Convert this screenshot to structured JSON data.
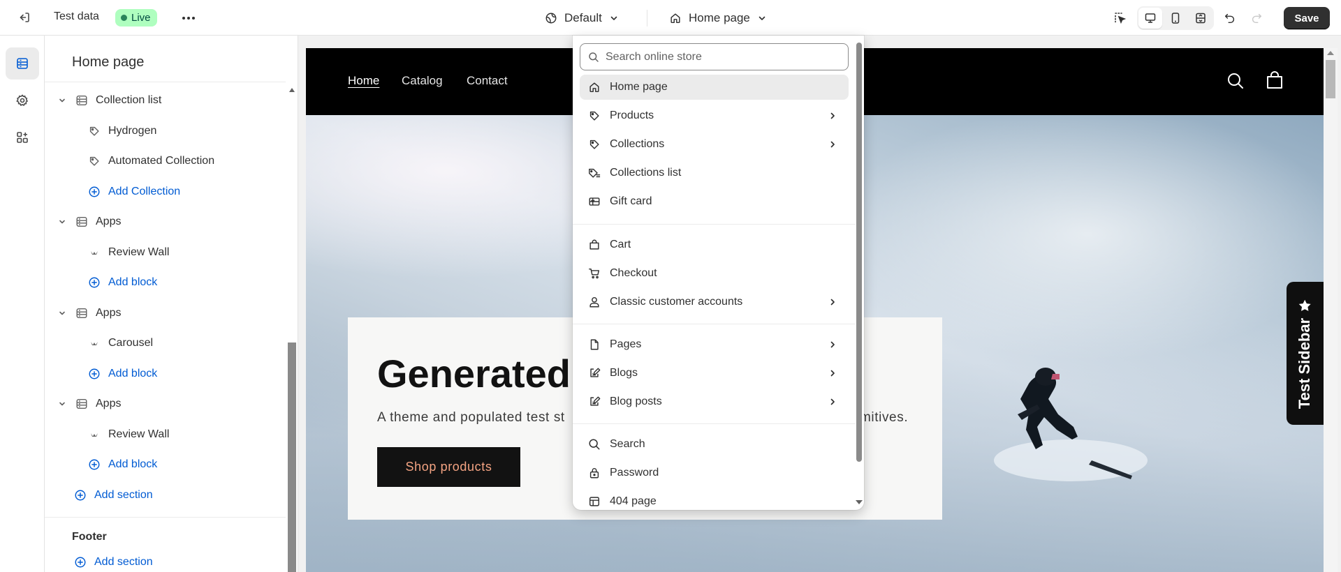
{
  "topbar": {
    "store_name": "Test data",
    "status": "Live",
    "theme": "Default",
    "template": "Home page",
    "save_label": "Save"
  },
  "sidebar": {
    "title": "Home page",
    "rows": [
      {
        "type": "section",
        "label": "Collection list",
        "icon": "section-icon"
      },
      {
        "type": "block",
        "label": "Hydrogen",
        "icon": "tag-icon"
      },
      {
        "type": "block",
        "label": "Automated Collection",
        "icon": "tag-icon"
      },
      {
        "type": "add",
        "label": "Add Collection",
        "icon": "add-circle-icon"
      },
      {
        "type": "section",
        "label": "Apps",
        "icon": "section-icon"
      },
      {
        "type": "block",
        "label": "Review Wall",
        "icon": "app-block-icon"
      },
      {
        "type": "add",
        "label": "Add block",
        "icon": "add-circle-icon"
      },
      {
        "type": "section",
        "label": "Apps",
        "icon": "section-icon"
      },
      {
        "type": "block",
        "label": "Carousel",
        "icon": "app-block-icon"
      },
      {
        "type": "add",
        "label": "Add block",
        "icon": "add-circle-icon"
      },
      {
        "type": "section",
        "label": "Apps",
        "icon": "section-icon"
      },
      {
        "type": "block",
        "label": "Review Wall",
        "icon": "app-block-icon"
      },
      {
        "type": "add",
        "label": "Add block",
        "icon": "add-circle-icon"
      },
      {
        "type": "add-section",
        "label": "Add section",
        "icon": "add-circle-icon"
      }
    ],
    "footer": {
      "label": "Footer",
      "add_label": "Add section"
    }
  },
  "preview": {
    "nav": [
      "Home",
      "Catalog",
      "Contact"
    ],
    "hero_title": "Generated t",
    "hero_text_left": "A theme and populated test st",
    "hero_text_right": "mitives.",
    "hero_button": "Shop products",
    "side_tab": "Test Sidebar"
  },
  "dropdown": {
    "search_placeholder": "Search online store",
    "items": [
      {
        "label": "Home page",
        "icon": "home-icon",
        "has_arrow": false
      },
      {
        "label": "Products",
        "icon": "tag-icon",
        "has_arrow": true
      },
      {
        "label": "Collections",
        "icon": "tag-icon",
        "has_arrow": true
      },
      {
        "label": "Collections list",
        "icon": "collections-list-icon",
        "has_arrow": false
      },
      {
        "label": "Gift card",
        "icon": "gift-card-icon",
        "has_arrow": false
      },
      {
        "label": "Cart",
        "icon": "bag-icon",
        "has_arrow": false
      },
      {
        "label": "Checkout",
        "icon": "cart-icon",
        "has_arrow": false
      },
      {
        "label": "Classic customer accounts",
        "icon": "person-icon",
        "has_arrow": true
      },
      {
        "label": "Pages",
        "icon": "page-icon",
        "has_arrow": true
      },
      {
        "label": "Blogs",
        "icon": "blog-icon",
        "has_arrow": true
      },
      {
        "label": "Blog posts",
        "icon": "blog-icon",
        "has_arrow": true
      },
      {
        "label": "Search",
        "icon": "search-icon",
        "has_arrow": false
      },
      {
        "label": "Password",
        "icon": "lock-icon",
        "has_arrow": false
      },
      {
        "label": "404 page",
        "icon": "page-404-icon",
        "has_arrow": false
      }
    ]
  },
  "colors": {
    "live_badge_bg": "#affebf",
    "live_badge_text": "#014b40",
    "link_blue": "#005bd3",
    "save_button": "#303030",
    "hero_button_text": "#f3a382"
  }
}
